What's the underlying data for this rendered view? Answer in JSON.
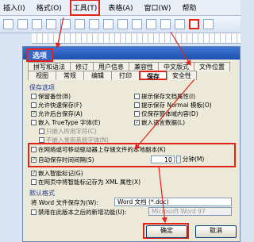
{
  "menubar": {
    "items": [
      "插入(I)",
      "格式(O)",
      "工具(T)",
      "表格(A)",
      "窗口(W)",
      "帮助"
    ]
  },
  "dialog": {
    "title": "选项",
    "tabs_top": [
      "拼写和语法",
      "修订",
      "用户信息",
      "兼容性",
      "中文版式",
      "文件位置"
    ],
    "tabs_bottom": [
      "视图",
      "常规",
      "编辑",
      "打印",
      "保存",
      "安全性"
    ],
    "active_tab": "保存",
    "save_section_title": "保存选项",
    "left_options": [
      {
        "label": "保留备份(B)",
        "checked": false
      },
      {
        "label": "允许快速保存(F)",
        "checked": false
      },
      {
        "label": "允许后台保存(A)",
        "checked": true
      },
      {
        "label": "嵌入 TrueType 字体(E)",
        "checked": false
      }
    ],
    "sub_options": [
      "只嵌入所用字符(C)",
      "不嵌入常用系统字体(N)"
    ],
    "right_options": [
      {
        "label": "提示保存文档属性(I)",
        "checked": false
      },
      {
        "label": "提示保存 Normal 模板(O)",
        "checked": false
      },
      {
        "label": "仅保存窗体域内容(D)",
        "checked": false
      },
      {
        "label": "嵌入语言数据(L)",
        "checked": true
      }
    ],
    "network_copy": {
      "label": "在网络或可移动驱动器上存储文件的本地副本(K)",
      "checked": false
    },
    "autorecover": {
      "label": "自动保存时间间隔(S)",
      "checked": true,
      "value": "10",
      "unit": "分钟(M)"
    },
    "embed_tags": {
      "label": "嵌入智能标记(G)",
      "checked": true
    },
    "xml_tags": {
      "label": "在网页中将智能标记存为 XML 属性(X)",
      "checked": false
    },
    "default_section_title": "默认格式",
    "save_as_label": "将 Word 文件保存为(W):",
    "save_as_value": "Word 文档 (*.doc)",
    "disable_features": {
      "label": "禁用在此版本之后的新增功能(U):",
      "checked": false
    },
    "disable_value": "Microsoft Word 97",
    "ok_label": "确定",
    "cancel_label": "取消"
  },
  "colors": {
    "highlight": "#e2231a",
    "title_bar": "#2a5bc0"
  }
}
